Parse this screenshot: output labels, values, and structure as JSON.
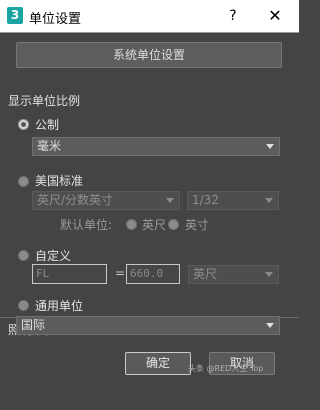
{
  "window": {
    "icon_text": "3",
    "title": "单位设置",
    "help_label": "?",
    "close_label": "✕"
  },
  "system_button": "系统单位设置",
  "display_scale": {
    "title": "显示单位比例",
    "metric": {
      "label": "公制",
      "selected": true,
      "unit_value": "毫米"
    },
    "us_standard": {
      "label": "美国标准",
      "selected": false,
      "unit_value": "英尺/分数英寸",
      "fraction_value": "1/32",
      "default_unit_label": "默认单位:",
      "feet_label": "英尺",
      "inches_label": "英寸"
    },
    "custom": {
      "label": "自定义",
      "selected": false,
      "name_value": "FL",
      "equals": "=",
      "amount_value": "660.0",
      "unit_value": "英尺"
    },
    "generic": {
      "label": "通用单位",
      "selected": false
    }
  },
  "lighting": {
    "title": "照明单位",
    "value": "国际"
  },
  "buttons": {
    "ok": "确定",
    "cancel": "取消"
  },
  "watermark": "头条 @RED人生 Top"
}
